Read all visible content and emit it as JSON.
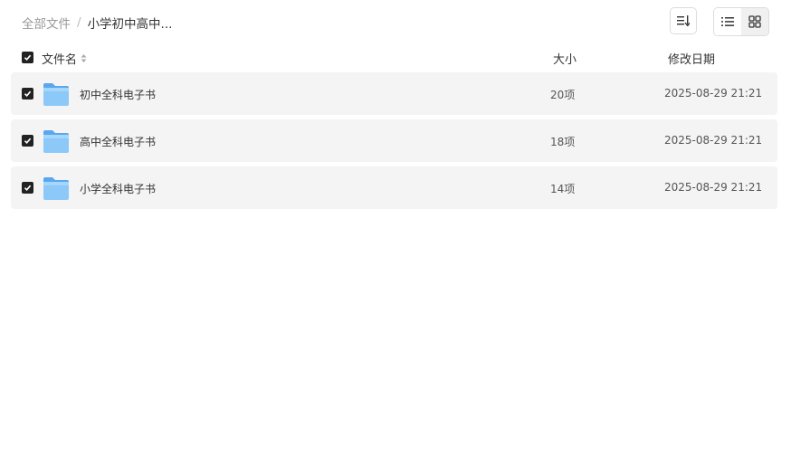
{
  "breadcrumb": {
    "root": "全部文件",
    "separator": "/",
    "current": "小学初中高中..."
  },
  "toolbar": {
    "sort_icon": "sort-list-icon",
    "view_list_icon": "list-view-icon",
    "view_grid_icon": "grid-view-icon"
  },
  "table": {
    "headers": {
      "name": "文件名",
      "size": "大小",
      "date": "修改日期"
    },
    "rows": [
      {
        "name": "初中全科电子书",
        "size": "20项",
        "date": "2025-08-29 21:21",
        "checked": true
      },
      {
        "name": "高中全科电子书",
        "size": "18项",
        "date": "2025-08-29 21:21",
        "checked": true
      },
      {
        "name": "小学全科电子书",
        "size": "14项",
        "date": "2025-08-29 21:21",
        "checked": true
      }
    ]
  },
  "colors": {
    "row_bg": "#f4f4f4",
    "folder_blue": "#6fb7f5",
    "checkbox": "#222222"
  }
}
